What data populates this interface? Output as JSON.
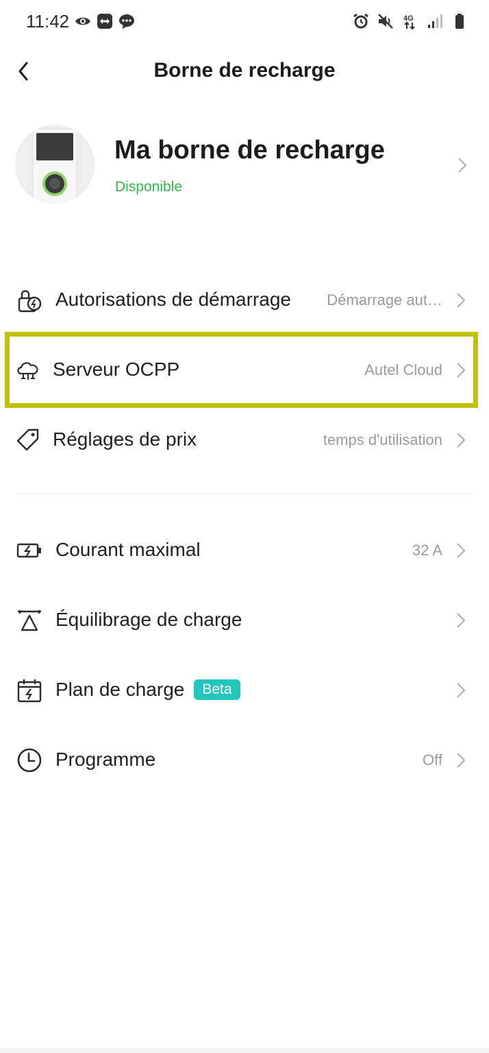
{
  "status_bar": {
    "time": "11:42",
    "left_icons": [
      "eye-icon",
      "teamviewer-icon",
      "message-icon"
    ],
    "right_icons": [
      "alarm-icon",
      "mute-icon",
      "network-4g-icon",
      "signal-icon",
      "battery-icon"
    ],
    "network": "4G"
  },
  "header": {
    "title": "Borne de recharge",
    "back_icon": "chevron-left-icon"
  },
  "device": {
    "name": "Ma borne de recharge",
    "status": "Disponible",
    "status_color": "#30b94b"
  },
  "settings_group_1": [
    {
      "icon": "lock-bolt-icon",
      "label": "Autorisations de démarrage",
      "value": "Démarrage aut…"
    },
    {
      "icon": "cloud-network-icon",
      "label": "Serveur OCPP",
      "value": "Autel Cloud",
      "highlighted": true
    },
    {
      "icon": "price-tag-icon",
      "label": "Réglages de prix",
      "value": "temps d'utilisation"
    }
  ],
  "settings_group_2": [
    {
      "icon": "battery-bolt-icon",
      "label": "Courant maximal",
      "value": "32 A"
    },
    {
      "icon": "load-balance-icon",
      "label": "Équilibrage de charge",
      "value": ""
    },
    {
      "icon": "calendar-bolt-icon",
      "label": "Plan de charge",
      "badge": "Beta",
      "value": ""
    },
    {
      "icon": "clock-icon",
      "label": "Programme",
      "value": "Off"
    }
  ],
  "colors": {
    "accent_badge": "#23c6be",
    "highlight_border": "#c2c20e",
    "muted_text": "#9a9a9a"
  }
}
